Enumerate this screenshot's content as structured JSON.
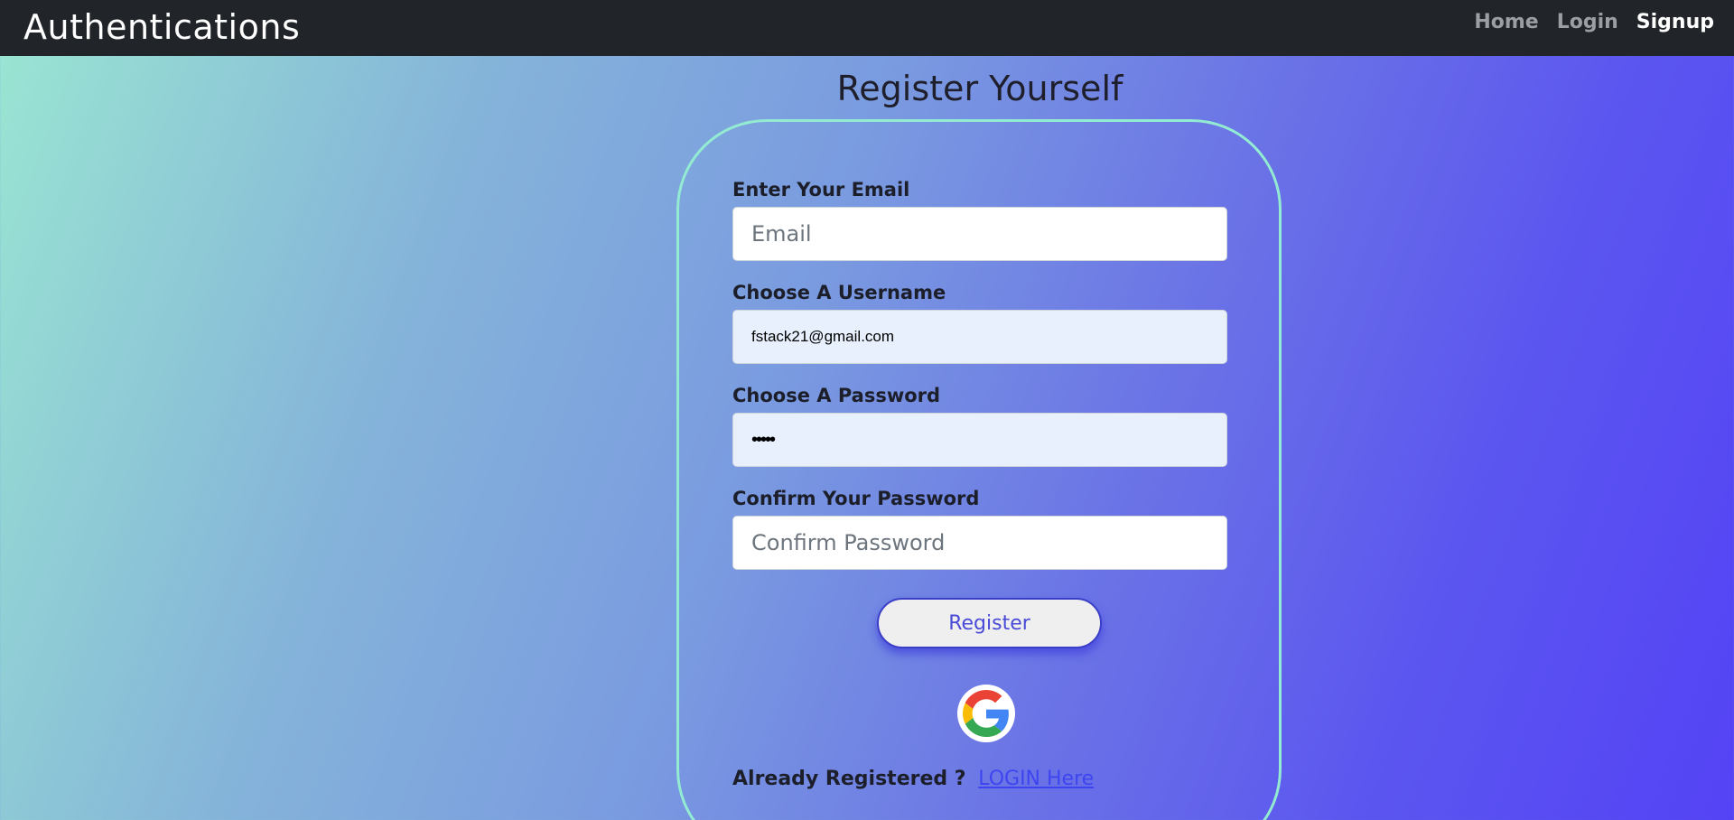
{
  "navbar": {
    "brand": "Authentications",
    "links": [
      {
        "label": "Home"
      },
      {
        "label": "Login"
      },
      {
        "label": "Signup"
      }
    ]
  },
  "page": {
    "title": "Register Yourself"
  },
  "form": {
    "email": {
      "label": "Enter Your Email",
      "placeholder": "Email",
      "value": ""
    },
    "username": {
      "label": "Choose A Username",
      "placeholder": "",
      "value": "fstack21@gmail.com"
    },
    "password": {
      "label": "Choose A Password",
      "value": "•••••"
    },
    "confirm": {
      "label": "Confirm Your Password",
      "placeholder": "Confirm Password",
      "value": ""
    },
    "register_label": "Register",
    "google_icon": "google-icon",
    "already_text": "Already Registered ?",
    "login_link": "LOGIN Here"
  },
  "colors": {
    "navbar_bg": "#212529",
    "card_border": "#93ecd2",
    "link": "#3d45f0",
    "button_text": "#4a4bd8"
  }
}
